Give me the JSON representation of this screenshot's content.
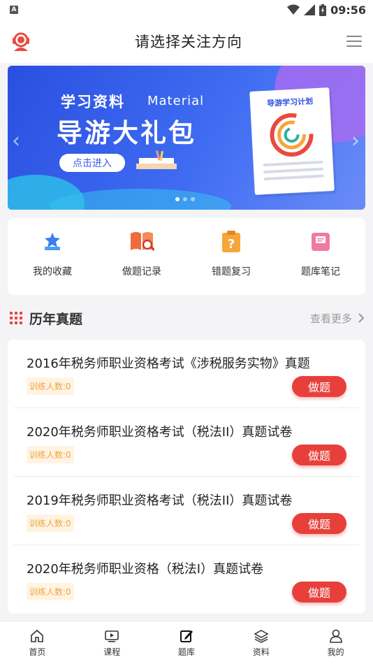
{
  "statusbar": {
    "app_badge": "A",
    "time": "09:56"
  },
  "header": {
    "title": "请选择关注方向"
  },
  "banner": {
    "tag": "学习资料",
    "tag_en": "Material",
    "title": "导游大礼包",
    "button": "点击进入",
    "paper_title": "导游学习计划"
  },
  "quick_menu": [
    {
      "label": "我的收藏",
      "icon": "star-badge-icon",
      "color": "#3a7ef0"
    },
    {
      "label": "做题记录",
      "icon": "book-search-icon",
      "color": "#f06a3c"
    },
    {
      "label": "错题复习",
      "icon": "question-clipboard-icon",
      "color": "#f6a53a"
    },
    {
      "label": "题库笔记",
      "icon": "notebook-icon",
      "color": "#f07aa0"
    }
  ],
  "section": {
    "title": "历年真题",
    "more": "查看更多"
  },
  "papers": [
    {
      "title": "2016年税务师职业资格考试《涉税服务实物》真题",
      "badge": "训练人数:0",
      "action": "做题"
    },
    {
      "title": "2020年税务师职业资格考试（税法II）真题试卷",
      "badge": "训练人数:0",
      "action": "做题"
    },
    {
      "title": "2019年税务师职业资格考试（税法II）真题试卷",
      "badge": "训练人数:0",
      "action": "做题"
    },
    {
      "title": "2020年税务师职业资格（税法I）真题试卷",
      "badge": "训练人数:0",
      "action": "做题"
    }
  ],
  "tabs": [
    {
      "label": "首页",
      "icon": "home-icon"
    },
    {
      "label": "课程",
      "icon": "video-icon"
    },
    {
      "label": "题库",
      "icon": "edit-icon"
    },
    {
      "label": "资料",
      "icon": "layers-icon"
    },
    {
      "label": "我的",
      "icon": "user-icon"
    }
  ],
  "colors": {
    "accent": "#e7403b",
    "banner": "#3a5fe8"
  }
}
